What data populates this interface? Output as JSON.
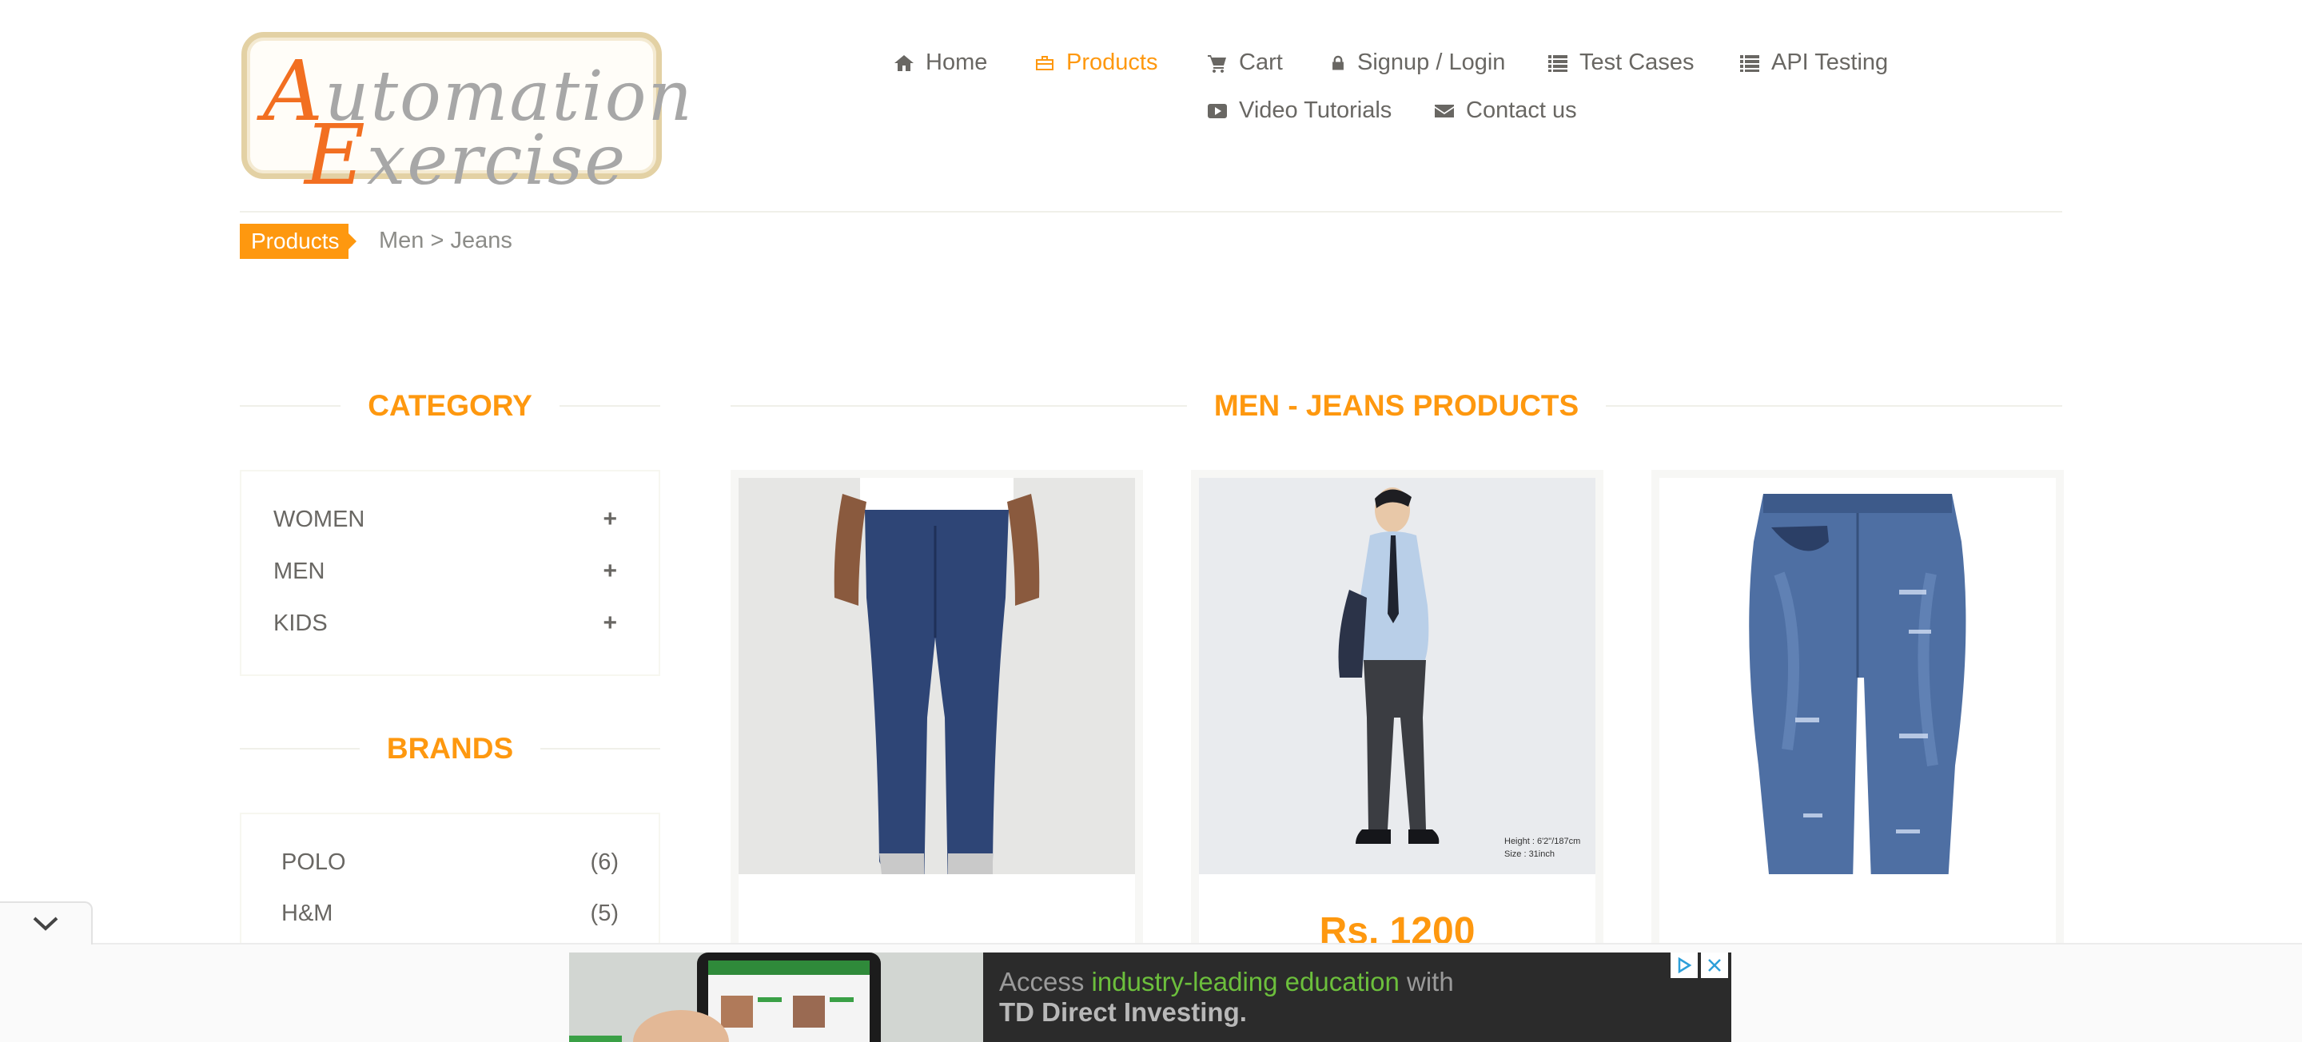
{
  "logo": {
    "line1_cap": "A",
    "line1_rest": "utomation",
    "line2_cap": "E",
    "line2_rest": "xercise"
  },
  "nav": [
    {
      "label": "Home",
      "icon": "home-icon"
    },
    {
      "label": "Products",
      "icon": "products-icon",
      "active": true
    },
    {
      "label": "Cart",
      "icon": "cart-icon"
    },
    {
      "label": "Signup / Login",
      "icon": "lock-icon"
    },
    {
      "label": "Test Cases",
      "icon": "list-icon"
    },
    {
      "label": "API Testing",
      "icon": "list-icon"
    },
    {
      "label": "Video Tutorials",
      "icon": "youtube-play-icon"
    },
    {
      "label": "Contact us",
      "icon": "envelope-icon"
    }
  ],
  "breadcrumb": {
    "tag": "Products",
    "path": "Men > Jeans"
  },
  "sidebar": {
    "category_title": "Category",
    "categories": [
      {
        "label": "Women",
        "toggle": "+"
      },
      {
        "label": "Men",
        "toggle": "+"
      },
      {
        "label": "Kids",
        "toggle": "+"
      }
    ],
    "brands_title": "Brands",
    "brands": [
      {
        "name": "POLO",
        "count": "(6)"
      },
      {
        "name": "H&M",
        "count": "(5)"
      }
    ]
  },
  "main": {
    "title": "Men - Jeans Products",
    "products": [
      {
        "image": "jeans-legs-red-sneakers-photo"
      },
      {
        "image": "man-in-shirt-and-dark-jeans-photo",
        "price": "Rs. 1200",
        "overlay_line1": "Height : 6'2\"/187cm",
        "overlay_line2": "Size : 31inch"
      },
      {
        "image": "ripped-blue-jeans-photo"
      }
    ]
  },
  "ad": {
    "text_a": "Access ",
    "text_highlight": "industry-leading education",
    "text_b": " with",
    "text_bold": "TD Direct Investing.",
    "icons": [
      "ad-choices-icon",
      "close-icon"
    ]
  },
  "colors": {
    "accent": "#fe980f",
    "text": "#696763",
    "rule": "#f0f0e9",
    "logo_orange": "#f26f21"
  }
}
